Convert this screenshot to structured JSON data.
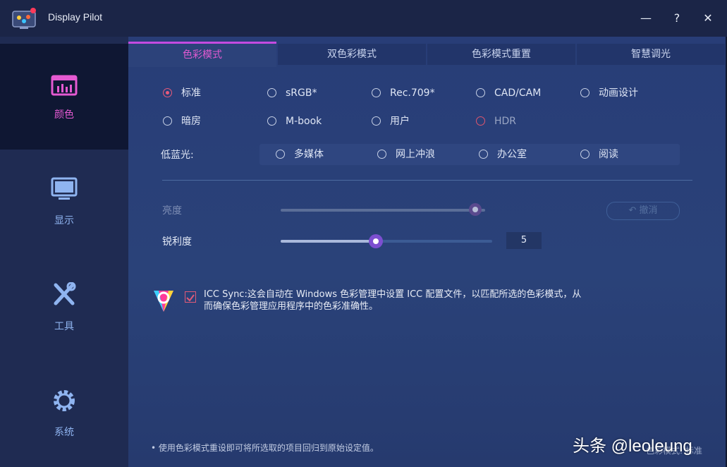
{
  "app": {
    "title": "Display Pilot"
  },
  "window_controls": {
    "minimize": "—",
    "help": "?",
    "close": "✕"
  },
  "sidebar": {
    "items": [
      {
        "label": "颜色",
        "icon": "color-bars-icon",
        "active": true
      },
      {
        "label": "显示",
        "icon": "monitor-icon",
        "active": false
      },
      {
        "label": "工具",
        "icon": "tools-icon",
        "active": false
      },
      {
        "label": "系统",
        "icon": "gear-icon",
        "active": false
      }
    ]
  },
  "tabs": [
    {
      "label": "色彩模式",
      "active": true
    },
    {
      "label": "双色彩模式",
      "active": false
    },
    {
      "label": "色彩模式重置",
      "active": false
    },
    {
      "label": "智慧调光",
      "active": false
    }
  ],
  "color_modes": {
    "row1": [
      "标准",
      "sRGB*",
      "Rec.709*",
      "CAD/CAM",
      "动画设计"
    ],
    "row2": [
      "暗房",
      "M-book",
      "用户",
      "HDR"
    ],
    "selected": "标准"
  },
  "low_blue": {
    "label": "低蓝光:",
    "options": [
      "多媒体",
      "网上冲浪",
      "办公室",
      "阅读"
    ]
  },
  "brightness": {
    "label": "亮度",
    "value": 95
  },
  "sharpness": {
    "label": "锐利度",
    "value": "5",
    "fraction": 0.45
  },
  "undo": {
    "label": "撤消",
    "icon": "undo-arrow-icon"
  },
  "icc": {
    "checked": true,
    "text": "ICC Sync:这会自动在 Windows 色彩管理中设置 ICC 配置文件，以匹配所选的色彩模式，从而确保色彩管理应用程序中的色彩准确性。"
  },
  "footnote": "• 使用色彩模式重设即可将所选取的项目回归到原始设定值。",
  "status": "色彩模式: 标准",
  "watermark": "头条 @leoleung",
  "colors": {
    "accent": "#e05ad0",
    "radio_on": "#e85a7a",
    "slider_thumb": "#7c4fd0"
  }
}
